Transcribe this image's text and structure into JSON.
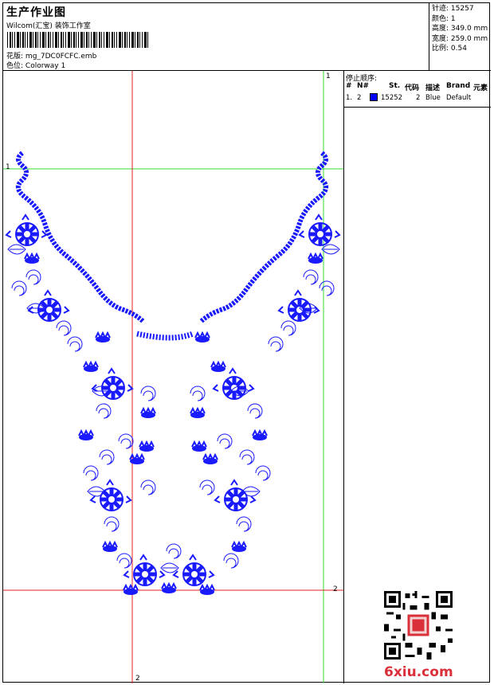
{
  "header": {
    "title": "生产作业图",
    "company": "Wilcom(汇宝) 装饰工作室",
    "design_label": "花版:",
    "design_value": "mg_7DC0FCFC.emb",
    "colorway_label": "色位:",
    "colorway_value": "Colorway 1"
  },
  "specs": [
    {
      "label": "针迹:",
      "value": "15257"
    },
    {
      "label": "颜色:",
      "value": "1"
    },
    {
      "label": "高度:",
      "value": "349.0 mm"
    },
    {
      "label": "宽度:",
      "value": "259.0 mm"
    },
    {
      "label": "比例:",
      "value": "0.54"
    }
  ],
  "stop_sequence": {
    "label": "停止顺序:",
    "columns": [
      "#",
      "N#",
      "St.",
      "代码",
      "描述",
      "Brand",
      "元素"
    ],
    "rows": [
      {
        "num": "1.",
        "n": "2",
        "color": "#0000ff",
        "st": "15252",
        "code": "2",
        "desc": "Blue",
        "brand": "Default",
        "elem": ""
      }
    ]
  },
  "guides": {
    "green_top_label": "1",
    "green_left_label": "1",
    "red_bottom_label": "2",
    "red_right_label": "2"
  },
  "colors": {
    "thread": "#1a1aff",
    "guide_green": "#33dd33",
    "guide_red": "#e02020"
  },
  "watermark": "6xiu.com"
}
